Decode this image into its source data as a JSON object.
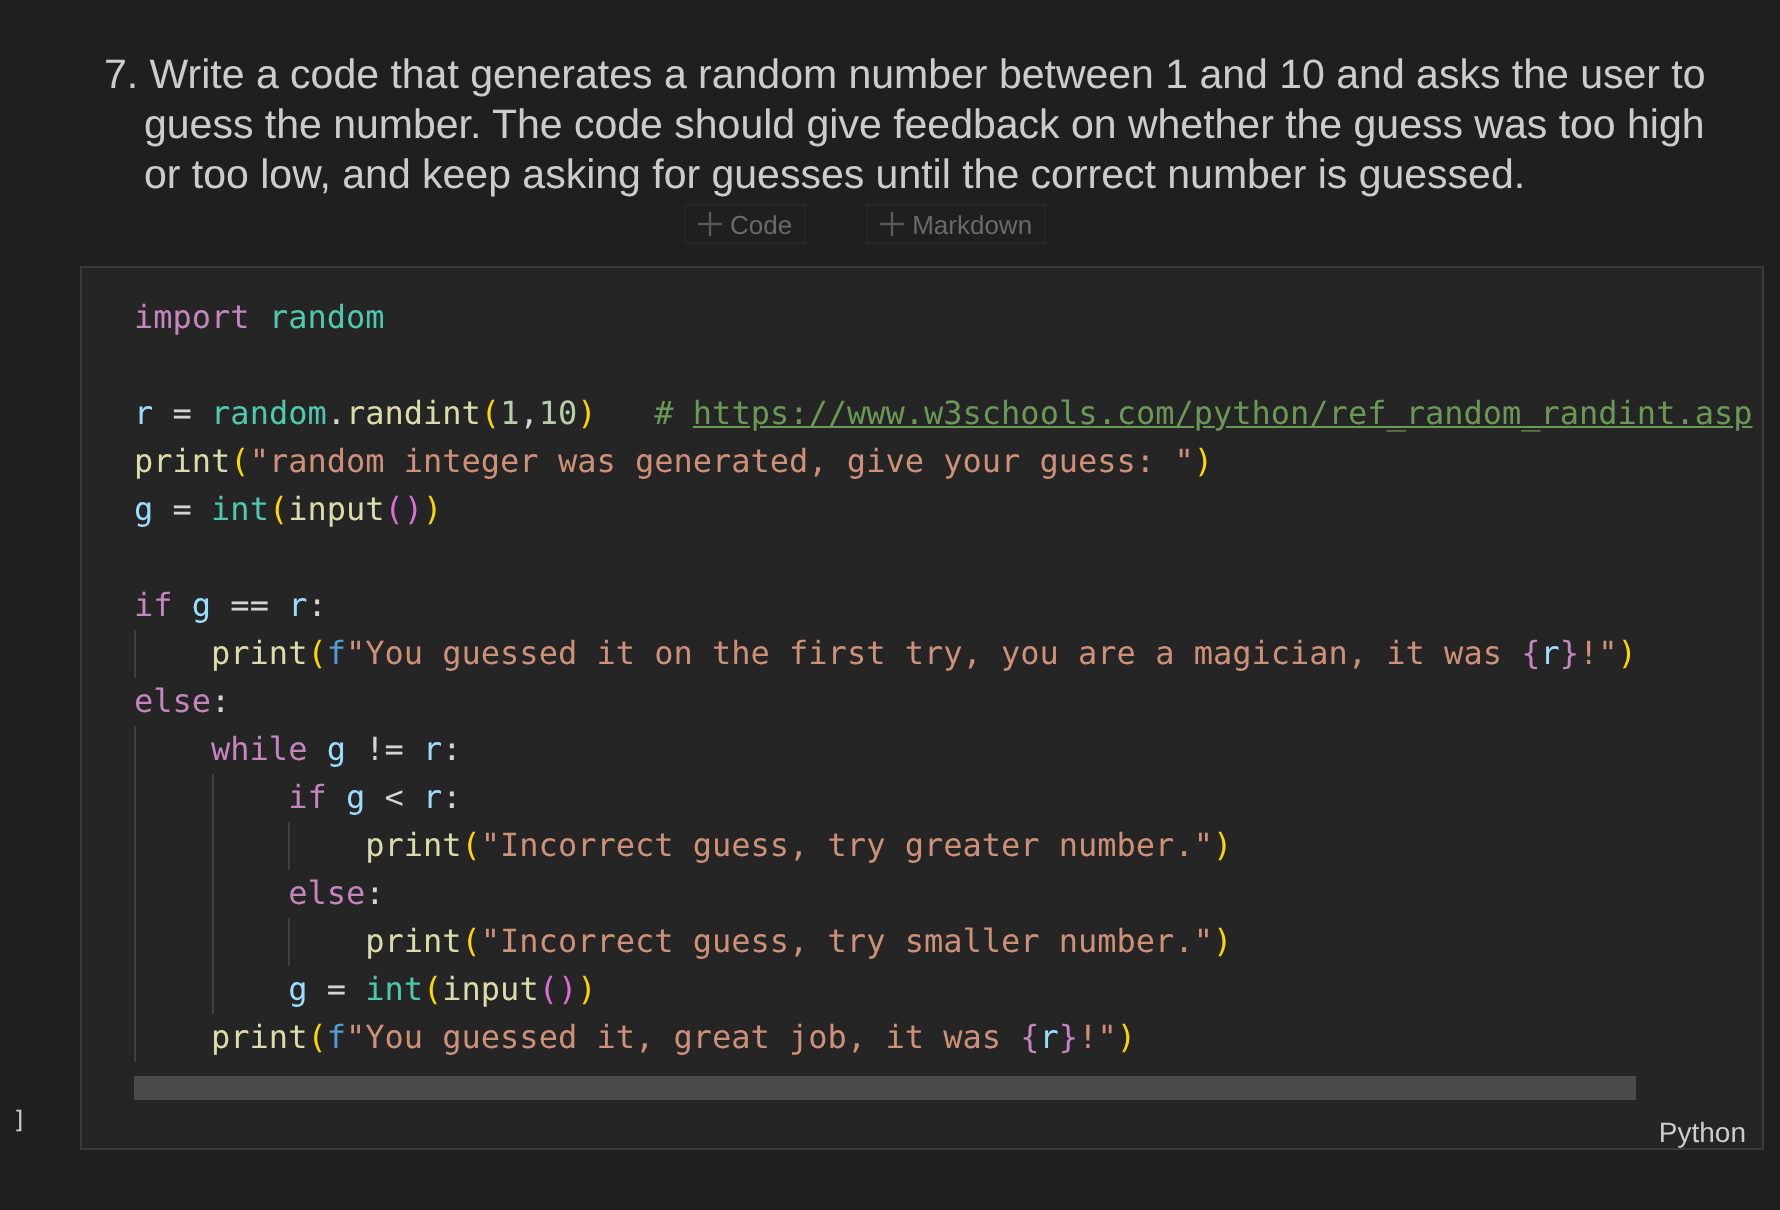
{
  "prompt": "7. Write a code that generates a random number between 1 and 10 and asks the user to guess the number. The code should give feedback on whether the guess was too high or too low, and keep asking for guesses until the correct number is guessed.",
  "insert_buttons": [
    {
      "label": "Code"
    },
    {
      "label": "Markdown"
    }
  ],
  "cell": {
    "bracket": "]",
    "language": "Python",
    "blocks": [
      [
        [
          {
            "kind": "keyword",
            "text": "import "
          },
          {
            "kind": "type",
            "text": "random"
          }
        ]
      ],
      [
        [
          {
            "kind": "variable",
            "text": "r"
          },
          {
            "kind": "plain",
            "text": " = "
          },
          {
            "kind": "type",
            "text": "random"
          },
          {
            "kind": "plain",
            "text": "."
          },
          {
            "kind": "function",
            "text": "randint"
          },
          {
            "kind": "paren",
            "text": "("
          },
          {
            "kind": "number",
            "text": "1"
          },
          {
            "kind": "plain",
            "text": ","
          },
          {
            "kind": "number",
            "text": "10"
          },
          {
            "kind": "paren",
            "text": ")"
          },
          {
            "kind": "comment",
            "text": "   # "
          },
          {
            "kind": "link",
            "text": "https://www.w3schools.com/python/ref_random_randint.asp"
          }
        ],
        [
          {
            "kind": "function",
            "text": "print"
          },
          {
            "kind": "paren",
            "text": "("
          },
          {
            "kind": "string",
            "text": "\"random integer was generated, give your guess: \""
          },
          {
            "kind": "paren",
            "text": ")"
          }
        ],
        [
          {
            "kind": "variable",
            "text": "g"
          },
          {
            "kind": "plain",
            "text": " = "
          },
          {
            "kind": "type",
            "text": "int"
          },
          {
            "kind": "paren",
            "text": "("
          },
          {
            "kind": "function",
            "text": "input"
          },
          {
            "kind": "paren2",
            "text": "()"
          },
          {
            "kind": "paren",
            "text": ")"
          }
        ]
      ],
      [
        [
          {
            "kind": "keyword",
            "text": "if "
          },
          {
            "kind": "variable",
            "text": "g"
          },
          {
            "kind": "plain",
            "text": " == "
          },
          {
            "kind": "variable",
            "text": "r"
          },
          {
            "kind": "plain",
            "text": ":"
          }
        ],
        [
          {
            "kind": "function",
            "text": "    print"
          },
          {
            "kind": "paren",
            "text": "("
          },
          {
            "kind": "prefix",
            "text": "f"
          },
          {
            "kind": "string",
            "text": "\"You guessed it on the first try, you are a magician, it was "
          },
          {
            "kind": "brace",
            "text": "{"
          },
          {
            "kind": "variable",
            "text": "r"
          },
          {
            "kind": "brace",
            "text": "}"
          },
          {
            "kind": "string",
            "text": "!\""
          },
          {
            "kind": "paren",
            "text": ")"
          }
        ],
        [
          {
            "kind": "keyword",
            "text": "else"
          },
          {
            "kind": "plain",
            "text": ":"
          }
        ],
        [
          {
            "kind": "keyword",
            "text": "    while "
          },
          {
            "kind": "variable",
            "text": "g"
          },
          {
            "kind": "plain",
            "text": " != "
          },
          {
            "kind": "variable",
            "text": "r"
          },
          {
            "kind": "plain",
            "text": ":"
          }
        ],
        [
          {
            "kind": "keyword",
            "text": "        if "
          },
          {
            "kind": "variable",
            "text": "g"
          },
          {
            "kind": "plain",
            "text": " < "
          },
          {
            "kind": "variable",
            "text": "r"
          },
          {
            "kind": "plain",
            "text": ":"
          }
        ],
        [
          {
            "kind": "function",
            "text": "            print"
          },
          {
            "kind": "paren",
            "text": "("
          },
          {
            "kind": "string",
            "text": "\"Incorrect guess, try greater number.\""
          },
          {
            "kind": "paren",
            "text": ")"
          }
        ],
        [
          {
            "kind": "keyword",
            "text": "        else"
          },
          {
            "kind": "plain",
            "text": ":"
          }
        ],
        [
          {
            "kind": "function",
            "text": "            print"
          },
          {
            "kind": "paren",
            "text": "("
          },
          {
            "kind": "string",
            "text": "\"Incorrect guess, try smaller number.\""
          },
          {
            "kind": "paren",
            "text": ")"
          }
        ],
        [
          {
            "kind": "variable",
            "text": "        g"
          },
          {
            "kind": "plain",
            "text": " = "
          },
          {
            "kind": "type",
            "text": "int"
          },
          {
            "kind": "paren",
            "text": "("
          },
          {
            "kind": "function",
            "text": "input"
          },
          {
            "kind": "paren2",
            "text": "()"
          },
          {
            "kind": "paren",
            "text": ")"
          }
        ],
        [
          {
            "kind": "function",
            "text": "    print"
          },
          {
            "kind": "paren",
            "text": "("
          },
          {
            "kind": "prefix",
            "text": "f"
          },
          {
            "kind": "string",
            "text": "\"You guessed it, great job, it was "
          },
          {
            "kind": "brace",
            "text": "{"
          },
          {
            "kind": "variable",
            "text": "r"
          },
          {
            "kind": "brace",
            "text": "}"
          },
          {
            "kind": "string",
            "text": "!\""
          },
          {
            "kind": "paren",
            "text": ")"
          }
        ]
      ]
    ]
  }
}
